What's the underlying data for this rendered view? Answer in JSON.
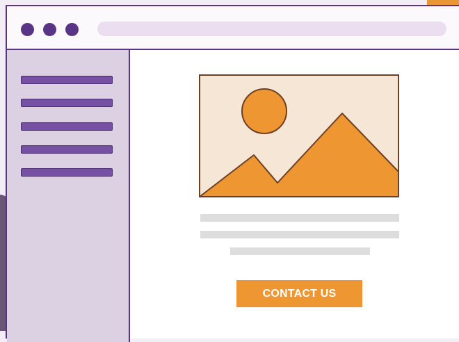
{
  "window": {
    "controls": [
      "dot",
      "dot",
      "dot"
    ],
    "address_bar": {
      "value": ""
    }
  },
  "sidebar": {
    "items": [
      "menu-line",
      "menu-line",
      "menu-line",
      "menu-line",
      "menu-line"
    ]
  },
  "main": {
    "hero_image": {
      "icon": "image-placeholder-icon"
    },
    "text_placeholder_lines": 3,
    "contact_button": {
      "label": "CONTACT US"
    }
  },
  "colors": {
    "brand_purple": "#5a3585",
    "sidebar_purple": "#dcd0e3",
    "menu_purple": "#7550a3",
    "accent_orange": "#ee9631",
    "image_background": "#f6e6d5",
    "placeholder_gray": "#dddddd"
  }
}
